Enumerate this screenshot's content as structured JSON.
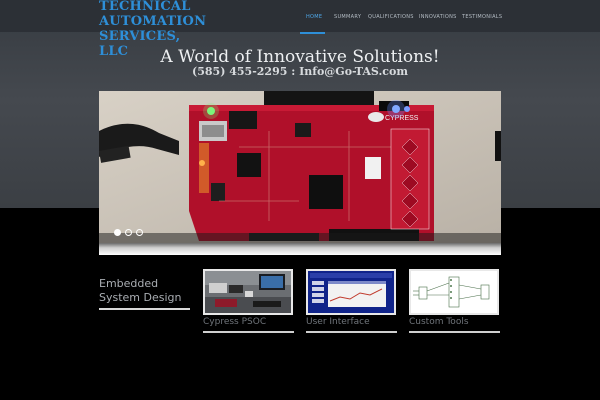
{
  "header": {
    "logo_line1": "TECHNICAL",
    "logo_line2": "AUTOMATION",
    "logo_line3": "SERVICES, LLC",
    "nav": [
      {
        "label": "HOME",
        "active": true
      },
      {
        "label": "SUMMARY"
      },
      {
        "label": "QUALIFICATIONS"
      },
      {
        "label": "INNOVATIONS"
      },
      {
        "label": "TESTIMONIALS"
      }
    ],
    "accent_color": "#2e8fd8"
  },
  "hero": {
    "tagline": "A World of Innovative Solutions!",
    "contact": "(585) 455-2295 : Info@Go-TAS.com",
    "slider": {
      "image": "red-cypress-psoc-dev-board-photo",
      "board_brand": "CYPRESS",
      "slides": 3,
      "active_slide": 1
    }
  },
  "section": {
    "title_line1": "Embedded",
    "title_line2": "System Design",
    "items": [
      {
        "label": "Cypress PSOC",
        "image": "lab-workbench-photo"
      },
      {
        "label": "User Interface",
        "image": "blue-ui-screenshot"
      },
      {
        "label": "Custom Tools",
        "image": "schematic-diagram"
      }
    ]
  }
}
